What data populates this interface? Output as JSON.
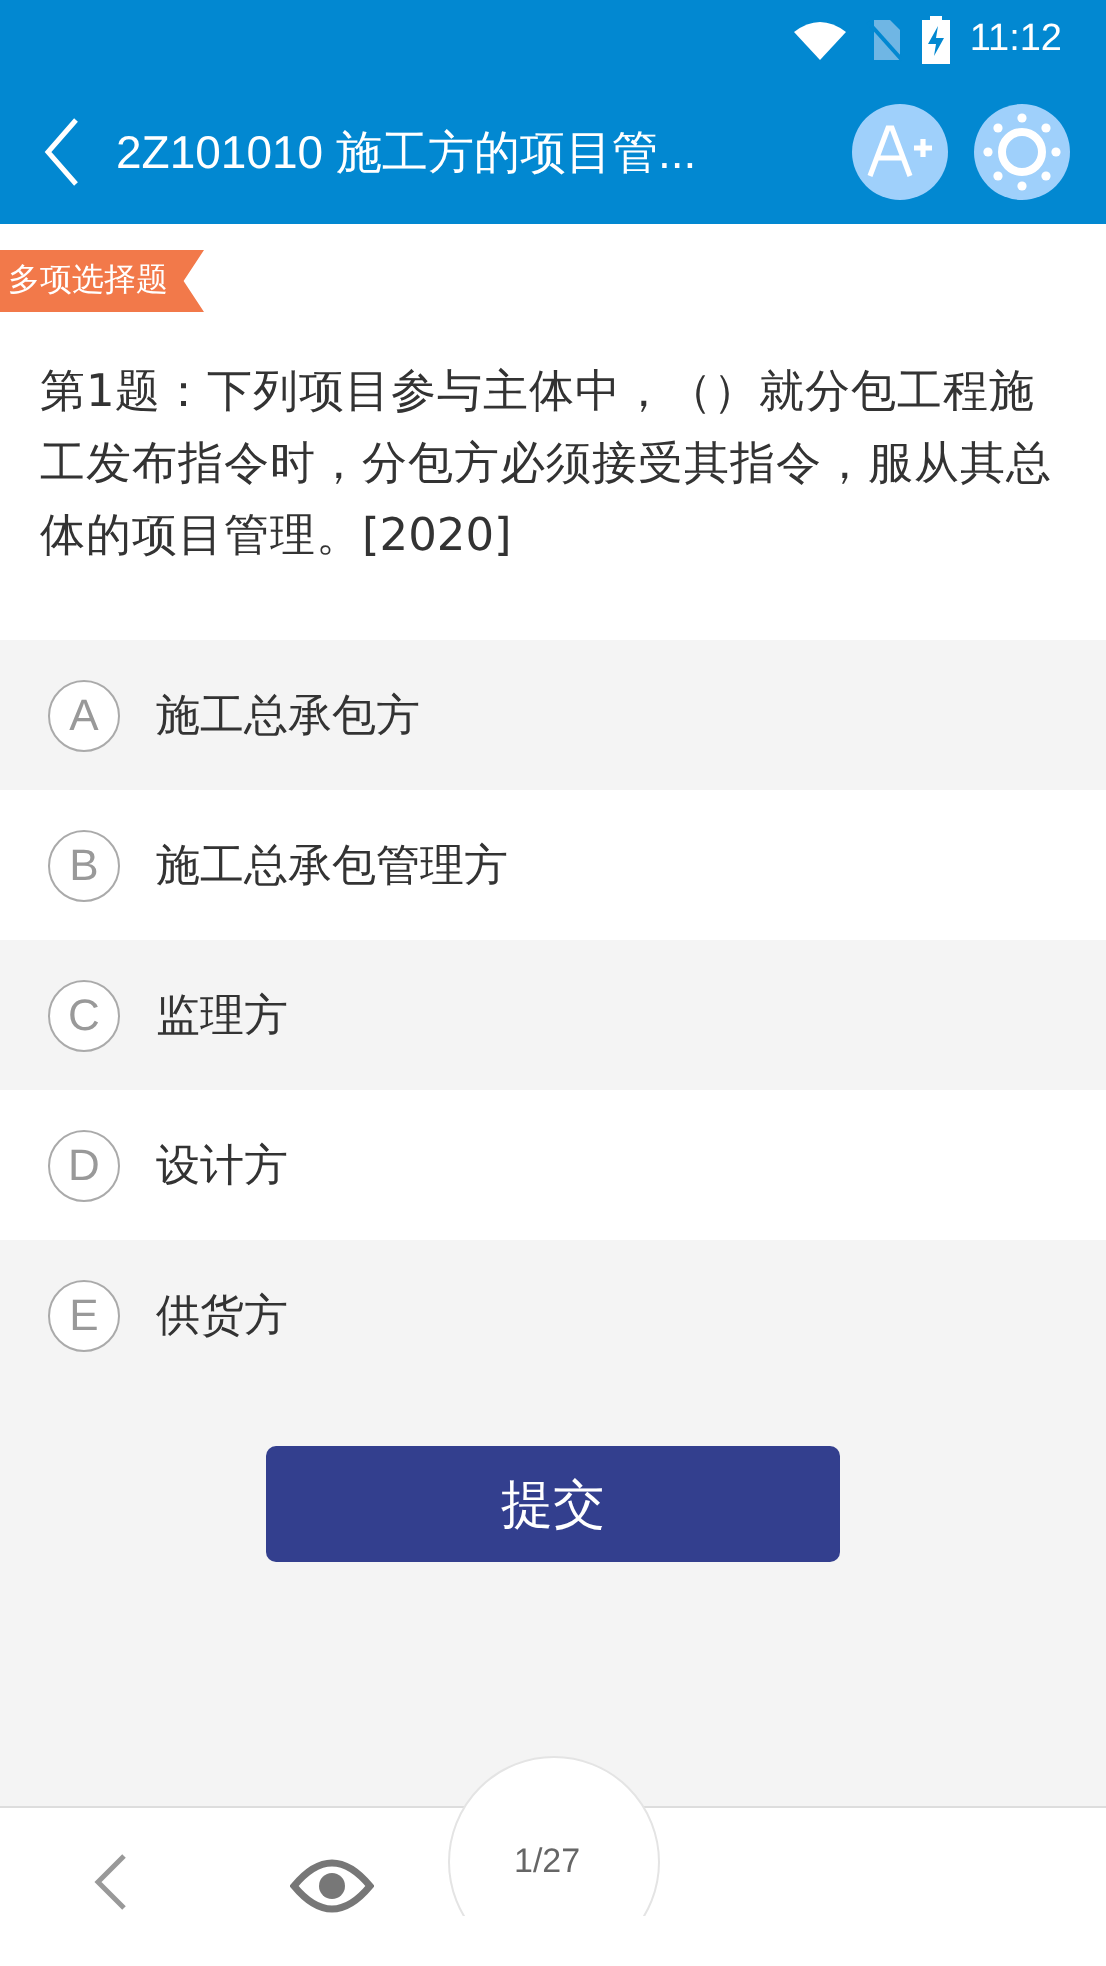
{
  "status_bar": {
    "time": "11:12"
  },
  "app_bar": {
    "title": "2Z101010 施工方的项目管..."
  },
  "question": {
    "type_tag": "多项选择题",
    "text": "第1题：下列项目参与主体中，（）就分包工程施工发布指令时，分包方必须接受其指令，服从其总体的项目管理。[2020]"
  },
  "options": [
    {
      "letter": "A",
      "text": "施工总承包方",
      "selected": false
    },
    {
      "letter": "B",
      "text": "施工总承包管理方",
      "selected": false
    },
    {
      "letter": "C",
      "text": "监理方",
      "selected": false
    },
    {
      "letter": "D",
      "text": "设计方",
      "selected": false
    },
    {
      "letter": "E",
      "text": "供货方",
      "selected": false
    }
  ],
  "submit_button": "提交",
  "bottom_bar": {
    "page_counter": "1/27"
  }
}
